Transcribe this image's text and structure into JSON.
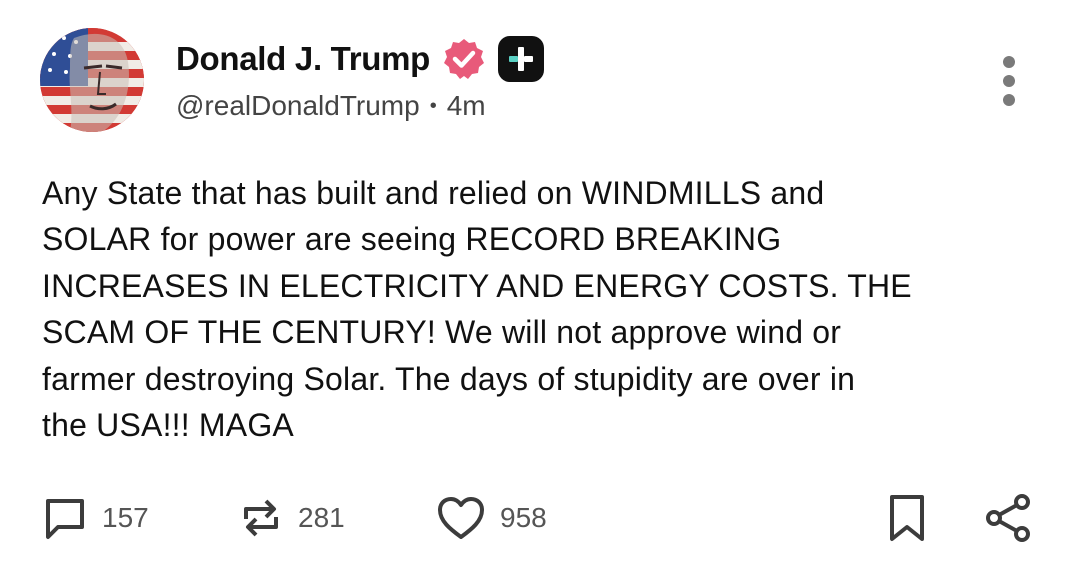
{
  "author": {
    "display_name": "Donald J. Trump",
    "handle": "@realDonaldTrump",
    "separator": "•",
    "time_ago": "4m",
    "verified_color": "#e85a7a"
  },
  "post": {
    "text": "Any State that has built and relied on WINDMILLS and\nSOLAR for power are seeing RECORD BREAKING\nINCREASES IN ELECTRICITY AND ENERGY COSTS. THE\nSCAM OF THE CENTURY! We will not approve wind or\nfarmer destroying Solar. The days of stupidity are over in\nthe USA!!! MAGA"
  },
  "actions": {
    "replies": "157",
    "restates": "281",
    "likes": "958"
  },
  "icons": {
    "reply": "comment-icon",
    "restate": "repost-icon",
    "like": "heart-icon",
    "bookmark": "bookmark-icon",
    "share": "share-icon",
    "more": "more-vertical-icon",
    "badge": "verified-badge-icon",
    "app": "app-plus-icon"
  }
}
